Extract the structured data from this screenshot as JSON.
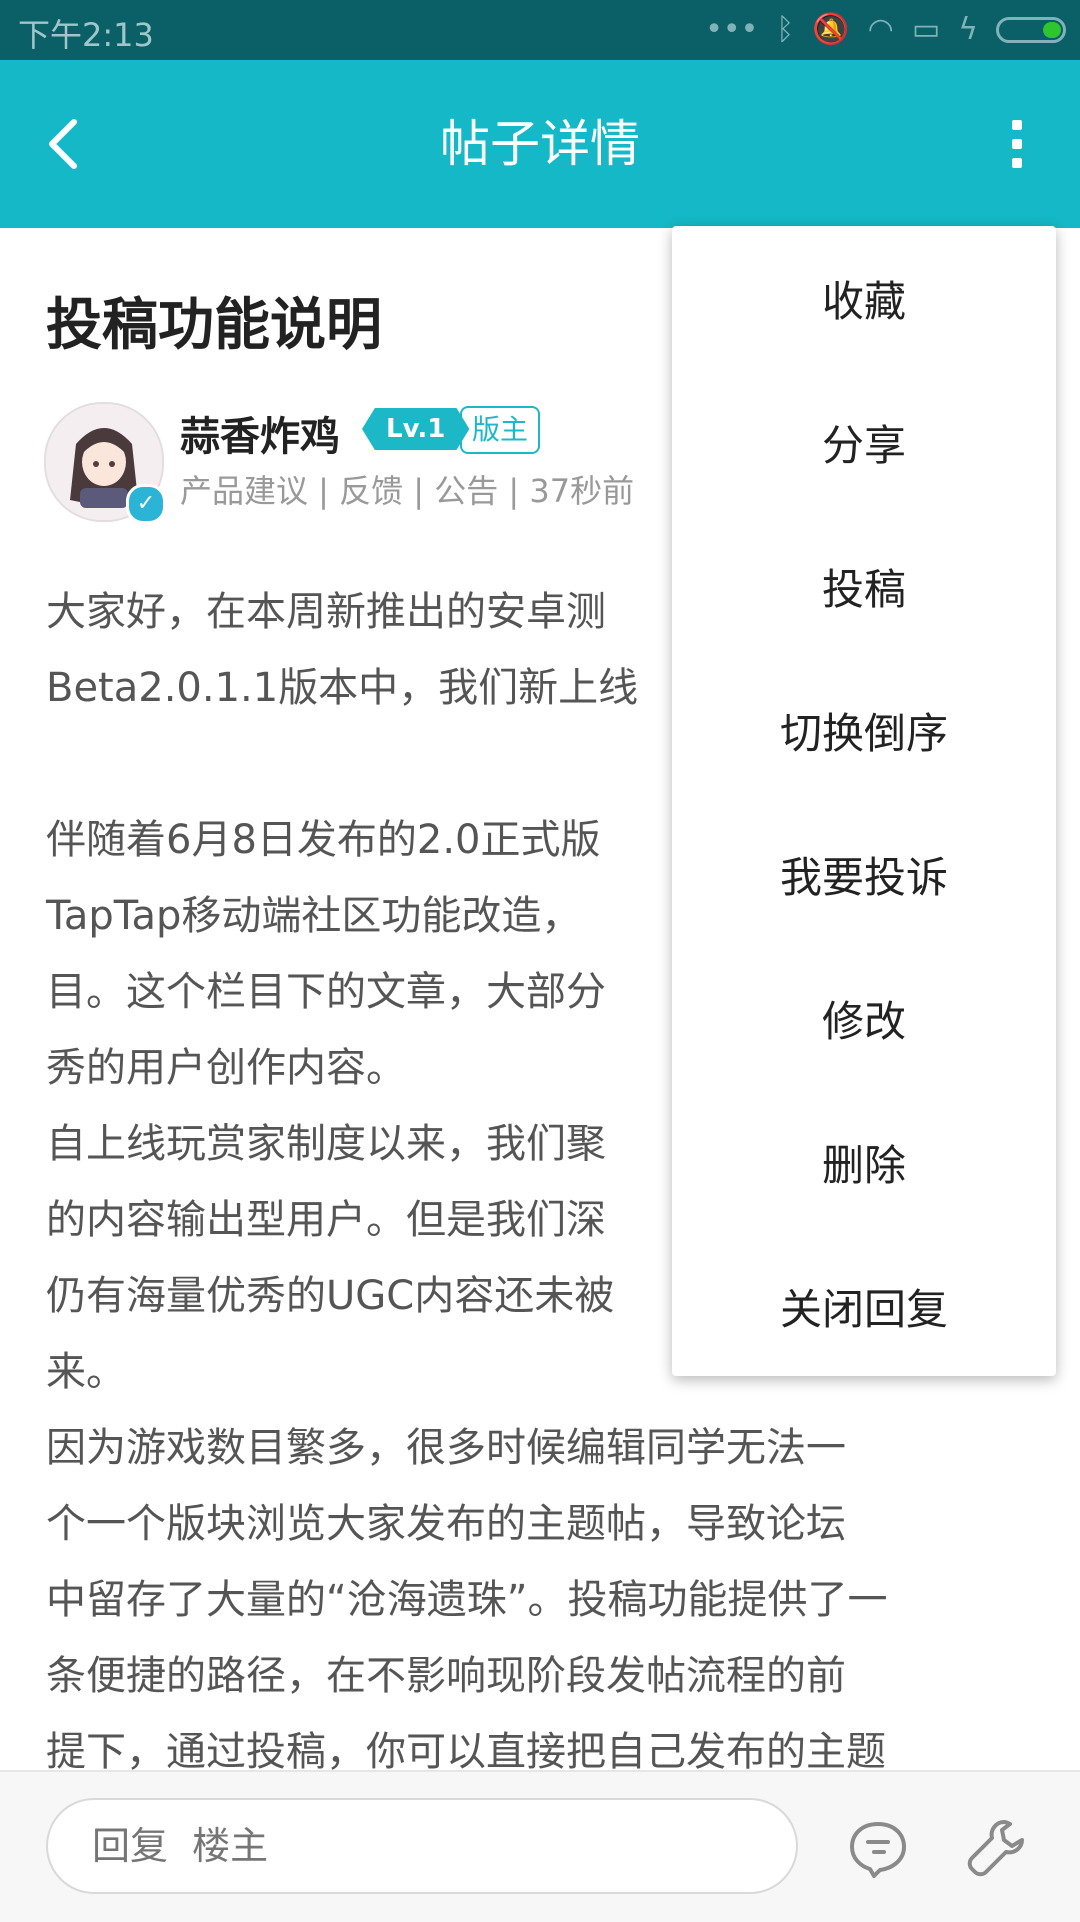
{
  "status_bar": {
    "time": "下午2:13"
  },
  "app_bar": {
    "title": "帖子详情"
  },
  "post": {
    "title": "投稿功能说明",
    "author": "蒜香炸鸡",
    "level_badge": "Lv.1",
    "role_badge": "版主",
    "meta": "产品建议 | 反馈 | 公告  |  37秒前",
    "paragraphs": [
      "大家好，在本周新推出的安卓测",
      "Beta2.0.1.1版本中，我们新上线",
      "",
      "伴随着6月8日发布的2.0正式版",
      "TapTap移动端社区功能改造，",
      "目。这个栏目下的文章，大部分",
      "秀的用户创作内容。",
      "自上线玩赏家制度以来，我们聚",
      "的内容输出型用户。但是我们深",
      "仍有海量优秀的UGC内容还未被",
      "来。",
      "因为游戏数目繁多，很多时候编辑同学无法一",
      "个一个版块浏览大家发布的主题帖，导致论坛",
      "中留存了大量的“沧海遗珠”。投稿功能提供了一",
      "条便捷的路径，在不影响现阶段发帖流程的前",
      "提下，通过投稿，你可以直接把自己发布的主题"
    ]
  },
  "menu": {
    "items": [
      "收藏",
      "分享",
      "投稿",
      "切换倒序",
      "我要投诉",
      "修改",
      "删除",
      "关闭回复"
    ]
  },
  "bottom_bar": {
    "reply_placeholder": "回复  楼主"
  },
  "colors": {
    "accent": "#15b8c6",
    "status_bar": "#0b5f66"
  }
}
